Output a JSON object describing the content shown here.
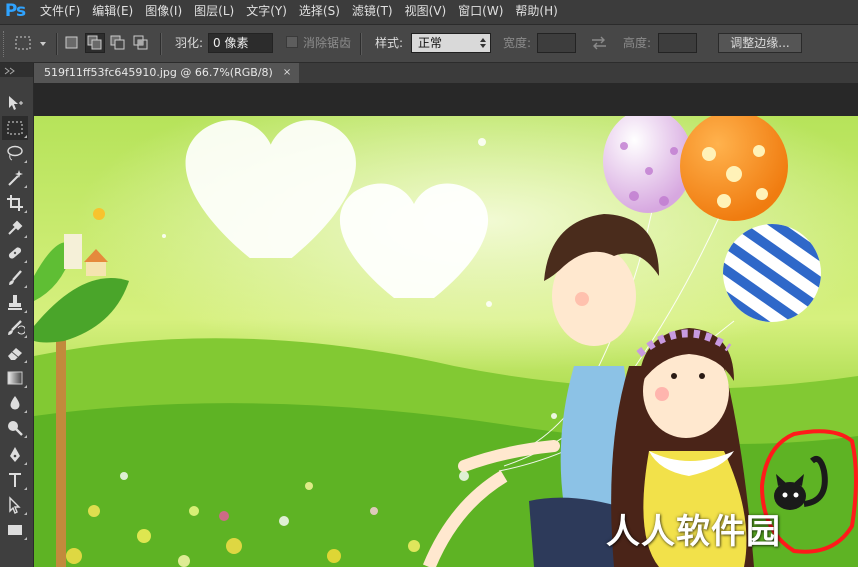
{
  "app": {
    "logo": "Ps"
  },
  "menu": [
    "文件(F)",
    "编辑(E)",
    "图像(I)",
    "图层(L)",
    "文字(Y)",
    "选择(S)",
    "滤镜(T)",
    "视图(V)",
    "窗口(W)",
    "帮助(H)"
  ],
  "options": {
    "feather_label": "羽化:",
    "feather_value": "0 像素",
    "antialias_label": "消除锯齿",
    "style_label": "样式:",
    "style_value": "正常",
    "width_label": "宽度:",
    "height_label": "高度:",
    "refine_button": "调整边缘..."
  },
  "document": {
    "tab_title": "519f11ff53fc645910.jpg @ 66.7%(RGB/8)",
    "close": "×"
  },
  "tools": [
    "move-tool",
    "rectangular-marquee-tool",
    "lasso-tool",
    "magic-wand-tool",
    "crop-tool",
    "eyedropper-tool",
    "spot-healing-tool",
    "brush-tool",
    "clone-stamp-tool",
    "history-brush-tool",
    "eraser-tool",
    "gradient-tool",
    "blur-tool",
    "dodge-tool",
    "pen-tool",
    "type-tool",
    "path-selection-tool",
    "rectangle-tool"
  ],
  "watermark": "人人软件园",
  "colors": {
    "ps_blue": "#2fa3ff",
    "annotation_red": "#ff1a1a",
    "panel_dark": "#3c3c3c"
  }
}
